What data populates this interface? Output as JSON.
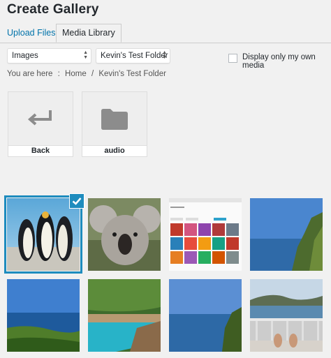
{
  "page": {
    "title": "Create Gallery"
  },
  "tabs": [
    {
      "label": "Upload Files"
    },
    {
      "label": "Media Library"
    }
  ],
  "filters": {
    "type_select": "Images",
    "folder_select": "Kevin's Test Folder",
    "own_media_label": "Display only my own media",
    "own_media_checked": false
  },
  "breadcrumb": {
    "prefix": "You are here",
    "separator": ":",
    "items": [
      "Home",
      "/",
      "Kevin's Test Folder"
    ]
  },
  "folders": [
    {
      "label": "Back",
      "icon": "return-arrow-icon"
    },
    {
      "label": "audio",
      "icon": "folder-icon"
    }
  ],
  "images": [
    {
      "subject": "penguins",
      "selected": true
    },
    {
      "subject": "koala",
      "selected": false
    },
    {
      "subject": "screenshot-grid",
      "selected": false
    },
    {
      "subject": "sea-cliff",
      "selected": false
    },
    {
      "subject": "coast-sea",
      "selected": false
    },
    {
      "subject": "pool-villa",
      "selected": false
    },
    {
      "subject": "ocean-cliff",
      "selected": false
    },
    {
      "subject": "balcony-view",
      "selected": false
    }
  ],
  "colors": {
    "accent": "#1e8cbe",
    "link": "#0073aa"
  }
}
